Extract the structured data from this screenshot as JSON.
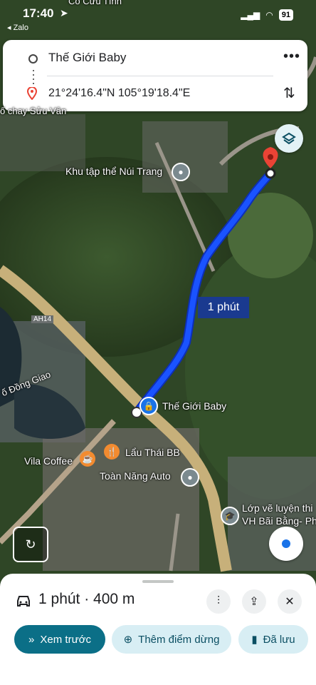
{
  "status_bar": {
    "time": "17:40",
    "back_app": "◂ Zalo",
    "battery": "91"
  },
  "route_card": {
    "origin": "Thế Giới Baby",
    "destination": "21°24'16.4\"N 105°19'18.4\"E"
  },
  "map": {
    "top_label": "Cô Cửu Tình",
    "labels": {
      "suu_van": "ố chay Sửu Vân",
      "khu_tap_the": "Khu tập thể Núi Trang",
      "ah14": "AH14",
      "dong_giao": "ố Đồng Giao",
      "the_gioi_baby": "Thế Giới Baby",
      "vila_coffee": "Vila Coffee",
      "lau_thai": "Lẩu Thái BB",
      "toan_nang": "Toàn Năng Auto",
      "lop_ve_1": "Lớp vẽ luyện thi",
      "lop_ve_2": "VH Bãi Bằng- Ph"
    },
    "eta_badge": "1 phút",
    "route_color": "#1a53ff"
  },
  "bottom_sheet": {
    "summary": "1 phút · 400 m",
    "preview_button": "Xem trước",
    "add_stop_button": "Thêm điểm dừng",
    "saved_button": "Đã lưu"
  },
  "icons": [
    "location-arrow-icon",
    "signal-icon",
    "wifi-icon",
    "more-icon",
    "swap-icon",
    "layers-icon",
    "pin-icon",
    "car-icon",
    "tune-icon",
    "share-icon",
    "close-icon",
    "street-view-icon",
    "my-location-icon",
    "forward-icon",
    "add-location-icon",
    "bookmark-icon",
    "coffee-icon",
    "restaurant-icon",
    "shopping-icon",
    "school-icon"
  ]
}
